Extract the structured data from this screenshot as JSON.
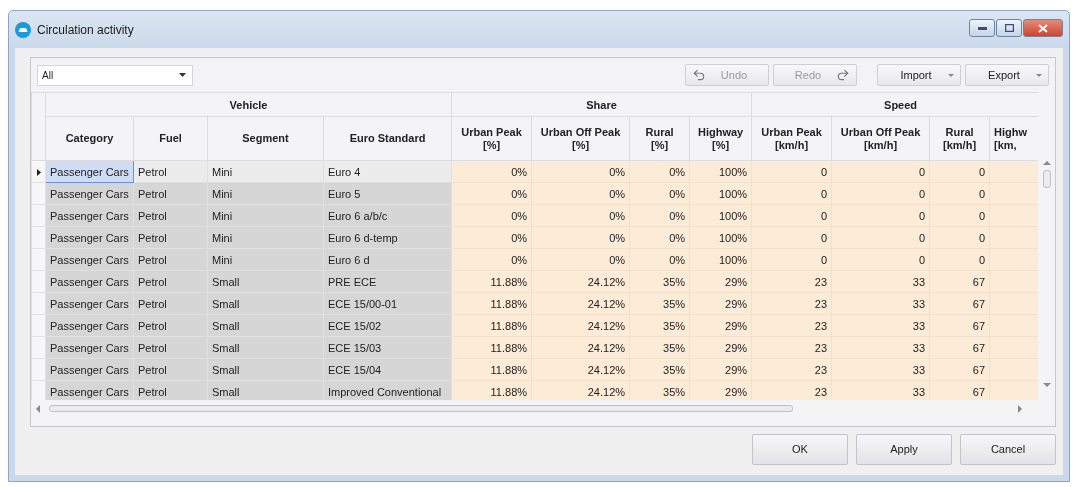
{
  "window": {
    "title": "Circulation activity"
  },
  "filter": {
    "value": "All"
  },
  "toolbar": [
    {
      "label": "Undo",
      "kind": "undo",
      "disabled": true
    },
    {
      "label": "Redo",
      "kind": "redo",
      "disabled": true
    },
    {
      "label": "Import",
      "kind": "menu",
      "disabled": false
    },
    {
      "label": "Export",
      "kind": "menu",
      "disabled": false
    }
  ],
  "table": {
    "groups": [
      {
        "label": "Vehicle",
        "columns": [
          {
            "lines": [
              "Category"
            ],
            "kind": "text"
          },
          {
            "lines": [
              "Fuel"
            ],
            "kind": "text"
          },
          {
            "lines": [
              "Segment"
            ],
            "kind": "text"
          },
          {
            "lines": [
              "Euro Standard"
            ],
            "kind": "text"
          }
        ]
      },
      {
        "label": "Share",
        "columns": [
          {
            "lines": [
              "Urban Peak",
              "[%]"
            ],
            "kind": "number"
          },
          {
            "lines": [
              "Urban Off Peak",
              "[%]"
            ],
            "kind": "number"
          },
          {
            "lines": [
              "Rural",
              "[%]"
            ],
            "kind": "number"
          },
          {
            "lines": [
              "Highway",
              "[%]"
            ],
            "kind": "number"
          }
        ]
      },
      {
        "label": "Speed",
        "columns": [
          {
            "lines": [
              "Urban Peak",
              "[km/h]"
            ],
            "kind": "number"
          },
          {
            "lines": [
              "Urban Off Peak",
              "[km/h]"
            ],
            "kind": "number"
          },
          {
            "lines": [
              "Rural",
              "[km/h]"
            ],
            "kind": "number"
          },
          {
            "lines": [
              "Highw",
              "[km,"
            ],
            "kind": "cut"
          }
        ]
      }
    ],
    "rows": [
      {
        "selected": true,
        "cells": [
          "Passenger Cars",
          "Petrol",
          "Mini",
          "Euro 4",
          "0%",
          "0%",
          "0%",
          "100%",
          "0",
          "0",
          "0"
        ]
      },
      {
        "selected": false,
        "cells": [
          "Passenger Cars",
          "Petrol",
          "Mini",
          "Euro 5",
          "0%",
          "0%",
          "0%",
          "100%",
          "0",
          "0",
          "0"
        ]
      },
      {
        "selected": false,
        "cells": [
          "Passenger Cars",
          "Petrol",
          "Mini",
          "Euro 6 a/b/c",
          "0%",
          "0%",
          "0%",
          "100%",
          "0",
          "0",
          "0"
        ]
      },
      {
        "selected": false,
        "cells": [
          "Passenger Cars",
          "Petrol",
          "Mini",
          "Euro 6 d-temp",
          "0%",
          "0%",
          "0%",
          "100%",
          "0",
          "0",
          "0"
        ]
      },
      {
        "selected": false,
        "cells": [
          "Passenger Cars",
          "Petrol",
          "Mini",
          "Euro 6 d",
          "0%",
          "0%",
          "0%",
          "100%",
          "0",
          "0",
          "0"
        ]
      },
      {
        "selected": false,
        "cells": [
          "Passenger Cars",
          "Petrol",
          "Small",
          "PRE ECE",
          "11.88%",
          "24.12%",
          "35%",
          "29%",
          "23",
          "33",
          "67"
        ]
      },
      {
        "selected": false,
        "cells": [
          "Passenger Cars",
          "Petrol",
          "Small",
          "ECE 15/00-01",
          "11.88%",
          "24.12%",
          "35%",
          "29%",
          "23",
          "33",
          "67"
        ]
      },
      {
        "selected": false,
        "cells": [
          "Passenger Cars",
          "Petrol",
          "Small",
          "ECE 15/02",
          "11.88%",
          "24.12%",
          "35%",
          "29%",
          "23",
          "33",
          "67"
        ]
      },
      {
        "selected": false,
        "cells": [
          "Passenger Cars",
          "Petrol",
          "Small",
          "ECE 15/03",
          "11.88%",
          "24.12%",
          "35%",
          "29%",
          "23",
          "33",
          "67"
        ]
      },
      {
        "selected": false,
        "cells": [
          "Passenger Cars",
          "Petrol",
          "Small",
          "ECE 15/04",
          "11.88%",
          "24.12%",
          "35%",
          "29%",
          "23",
          "33",
          "67"
        ]
      },
      {
        "selected": false,
        "cells": [
          "Passenger Cars",
          "Petrol",
          "Small",
          "Improved Conventional",
          "11.88%",
          "24.12%",
          "35%",
          "29%",
          "23",
          "33",
          "67"
        ]
      }
    ]
  },
  "buttons": [
    {
      "label": "OK"
    },
    {
      "label": "Apply"
    },
    {
      "label": "Cancel"
    }
  ]
}
